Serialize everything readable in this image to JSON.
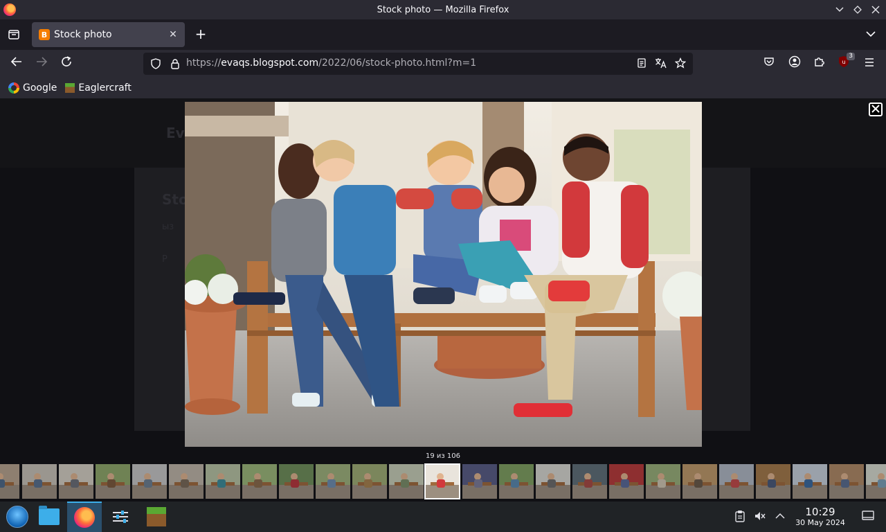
{
  "window": {
    "title": "Stock photo — Mozilla Firefox"
  },
  "tabs": [
    {
      "label": "Stock photo"
    }
  ],
  "nav": {
    "url_prefix": "https://",
    "url_host": "evaqs.blogspot.com",
    "url_path": "/2022/06/stock-photo.html?m=1"
  },
  "bookmarks": [
    {
      "label": "Google"
    },
    {
      "label": "Eaglercraft"
    }
  ],
  "extensions": {
    "ublock_badge": "3"
  },
  "background_page": {
    "header_text": "Ev",
    "heading_text": "Sto",
    "line1": "ыз",
    "line2": "Р"
  },
  "lightbox": {
    "counter": "19 из 106"
  },
  "taskbar": {
    "time": "10:29",
    "date": "30 May 2024"
  }
}
